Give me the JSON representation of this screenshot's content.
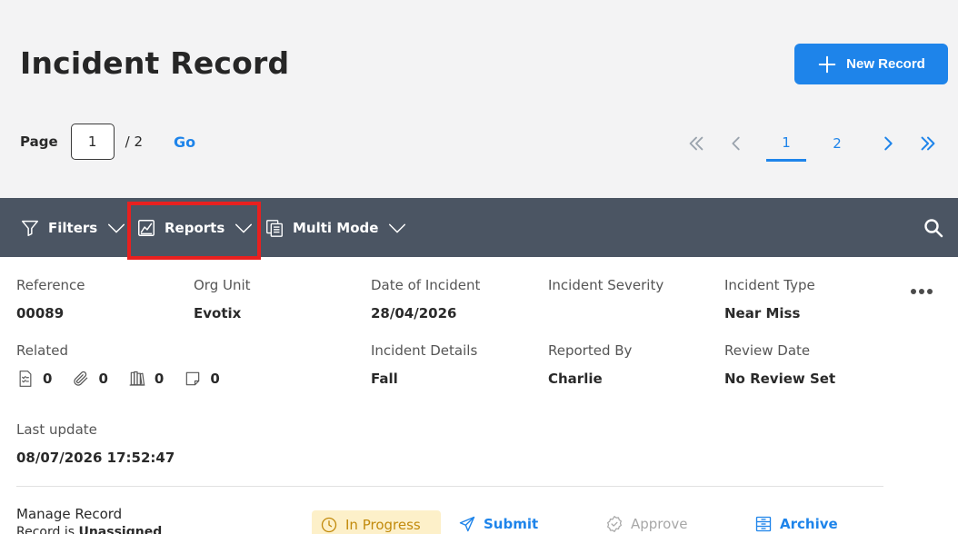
{
  "header": {
    "title": "Incident Record",
    "new_record_label": "New Record"
  },
  "pagination": {
    "page_label": "Page",
    "current_page": "1",
    "total_label": "/ 2",
    "go_label": "Go",
    "pages": [
      "1",
      "2"
    ],
    "active_page": "1"
  },
  "toolbar": {
    "filters_label": "Filters",
    "reports_label": "Reports",
    "multi_mode_label": "Multi Mode"
  },
  "record": {
    "reference": {
      "label": "Reference",
      "value": "00089"
    },
    "org_unit": {
      "label": "Org Unit",
      "value": "Evotix"
    },
    "date_of_incident": {
      "label": "Date of Incident",
      "value": "28/04/2026"
    },
    "incident_severity": {
      "label": "Incident Severity",
      "value": ""
    },
    "incident_type": {
      "label": "Incident Type",
      "value": "Near Miss"
    },
    "related": {
      "label": "Related",
      "checklists": "0",
      "attachments": "0",
      "library": "0",
      "notes": "0"
    },
    "incident_details": {
      "label": "Incident Details",
      "value": "Fall"
    },
    "reported_by": {
      "label": "Reported By",
      "value": "Charlie"
    },
    "review_date": {
      "label": "Review Date",
      "value": "No Review Set"
    },
    "last_update": {
      "label": "Last update",
      "value": "08/07/2026 17:52:47"
    }
  },
  "manage": {
    "title": "Manage Record",
    "assignment_prefix": "Record is ",
    "assignment_value": "Unassigned",
    "status": "In Progress",
    "submit_label": "Submit",
    "approve_label": "Approve",
    "archive_label": "Archive"
  },
  "colors": {
    "accent": "#1e84ea",
    "toolbar_bg": "#4b5563",
    "highlight": "#e8201f",
    "status_bg": "#fdf0c9",
    "status_text": "#c28a0c"
  },
  "icons": [
    "plus-icon",
    "first-page-icon",
    "previous-page-icon",
    "next-page-icon",
    "last-page-icon",
    "filter-icon",
    "chevron-down-icon",
    "report-chart-icon",
    "multi-mode-icon",
    "search-icon",
    "checklist-icon",
    "paperclip-icon",
    "library-icon",
    "note-icon",
    "more-options-icon",
    "clock-icon",
    "send-icon",
    "approve-badge-icon",
    "archive-icon"
  ]
}
